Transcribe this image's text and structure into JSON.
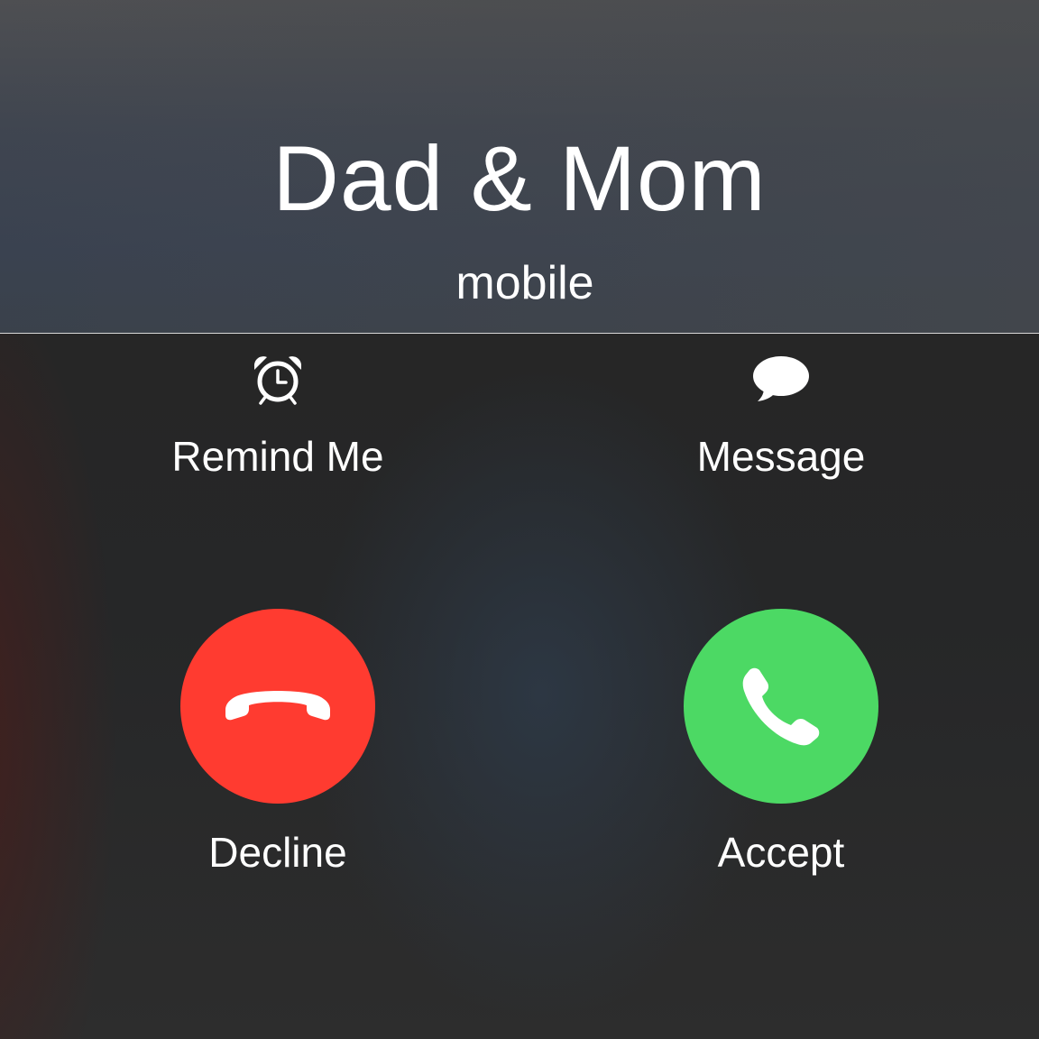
{
  "caller": {
    "name": "Dad & Mom",
    "type": "mobile"
  },
  "actions": {
    "remind": {
      "label": "Remind Me",
      "icon": "alarm-clock-icon"
    },
    "message": {
      "label": "Message",
      "icon": "speech-bubble-icon"
    }
  },
  "buttons": {
    "decline": {
      "label": "Decline",
      "icon": "phone-hangup-icon",
      "color": "#ff3b30"
    },
    "accept": {
      "label": "Accept",
      "icon": "phone-icon",
      "color": "#4cd964"
    }
  },
  "colors": {
    "label_text": "#ffffff"
  }
}
